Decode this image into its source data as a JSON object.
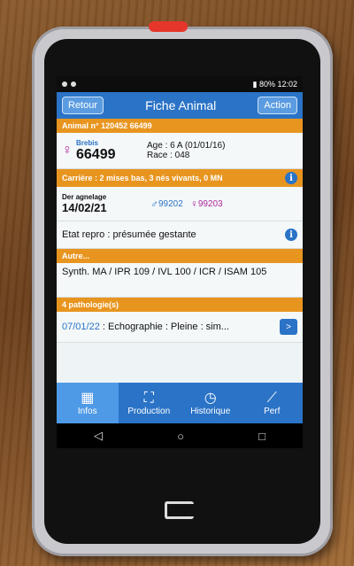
{
  "status": {
    "left_icons": "status-dots",
    "right_text": "▮ 80%  12:02"
  },
  "appbar": {
    "back_label": "Retour",
    "title": "Fiche Animal",
    "action_label": "Action"
  },
  "animal_header": "Animal n° 120452 66499",
  "animal": {
    "sex_label": "Brebis",
    "id": "66499",
    "age": "Age : 6 A (01/01/16)",
    "race": "Race : 048"
  },
  "carriere": "Carrière : 2 mises bas, 3 nés vivants, 0 MN",
  "agnelage": {
    "label": "Der agnelage",
    "date": "14/02/21",
    "male_id": "99202",
    "female_id": "99203"
  },
  "etat_repro": "Etat repro : présumée gestante",
  "autre_header": "Autre...",
  "synth": "Synth. MA / IPR 109 / IVL 100 / ICR / ISAM 105",
  "patho_header": "4 pathologie(s)",
  "patho_item": {
    "date": "07/01/22",
    "text": " : Echographie : Pleine : sim..."
  },
  "tabs": [
    {
      "label": "Infos",
      "icon": "infos-icon"
    },
    {
      "label": "Production",
      "icon": "production-icon"
    },
    {
      "label": "Historique",
      "icon": "historique-icon"
    },
    {
      "label": "Perf",
      "icon": "perf-icon"
    }
  ],
  "colors": {
    "primary": "#2a73c6",
    "accent": "#e8951f",
    "female": "#b0279a"
  }
}
